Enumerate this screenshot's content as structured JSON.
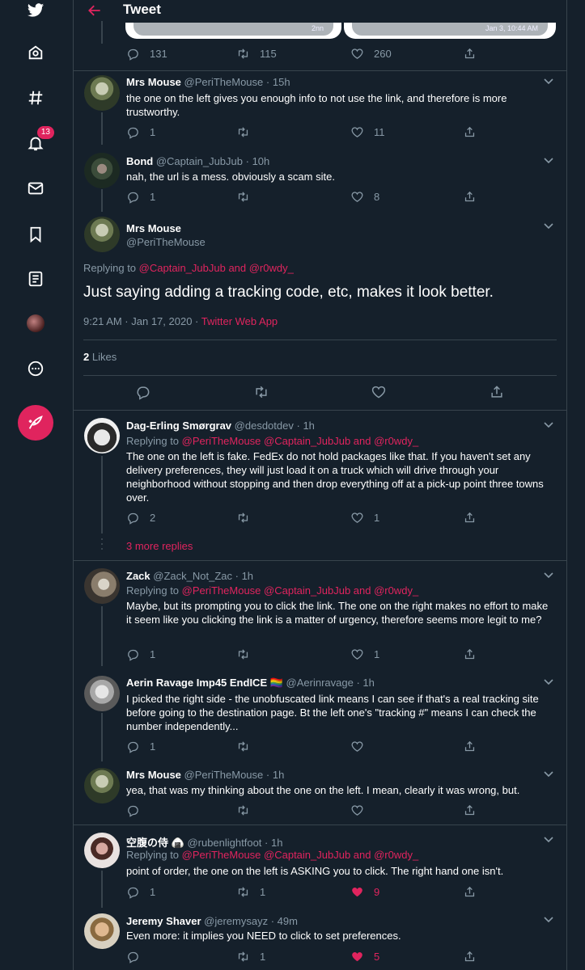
{
  "header": {
    "title": "Tweet"
  },
  "nav": {
    "notification_count": "13"
  },
  "media": {
    "left_caption": "2nn",
    "right_caption": "Jan 3, 10:44 AM"
  },
  "top_tweet": {
    "replies": "131",
    "retweets": "115",
    "likes": "260"
  },
  "tweets": [
    {
      "name": "Mrs Mouse",
      "handle": "@PeriTheMouse",
      "time": "15h",
      "text": "the one on the left gives you enough info to not use the link, and therefore is more trustworthy.",
      "replies": "1",
      "retweets": "",
      "likes": "11"
    },
    {
      "name": "Bond",
      "handle": "@Captain_JubJub",
      "time": "10h",
      "text": "nah, the url is a mess. obviously a scam site.",
      "replies": "1",
      "retweets": "",
      "likes": "8"
    }
  ],
  "focused": {
    "name": "Mrs Mouse",
    "handle": "@PeriTheMouse",
    "replying_prefix": "Replying to",
    "replying_to": "@Captain_JubJub and @r0wdy_",
    "text": "Just saying adding a tracking code, etc, makes it look better.",
    "timestamp": "9:21 AM · Jan 17, 2020 · ",
    "source": "Twitter Web App",
    "likes_count": "2",
    "likes_label": "Likes"
  },
  "replies": [
    {
      "name": "Dag-Erling Smørgrav",
      "handle": "@desdotdev",
      "time": "1h",
      "replying_prefix": "Replying to",
      "replying_to": "@PeriTheMouse @Captain_JubJub and @r0wdy_",
      "text": "The one on the left is fake. FedEx do not hold packages like that. If you haven't set any delivery preferences, they will just load it on a truck which will drive through your neighborhood without stopping and then drop everything off at a pick-up point three towns over.",
      "replies": "2",
      "retweets": "",
      "likes": "1"
    },
    {
      "more_replies": "3 more replies"
    },
    {
      "name": "Zack",
      "handle": "@Zack_Not_Zac",
      "time": "1h",
      "replying_prefix": "Replying to",
      "replying_to": "@PeriTheMouse @Captain_JubJub and @r0wdy_",
      "text": "Maybe, but its prompting you to click the link. The one on the right makes no effort to make it seem like you clicking the link is a matter of urgency, therefore seems more legit to me?",
      "replies": "1",
      "retweets": "",
      "likes": "1"
    },
    {
      "name": "Aerin Ravage Imp45 EndICE 🏳️‍🌈",
      "handle": "@Aerinravage",
      "time": "1h",
      "text": "I picked the right side - the unobfuscated link means I can see if that's a real tracking site before going to the destination page. Bt the left one's \"tracking #\" means I can check the number independently...",
      "replies": "1",
      "retweets": "",
      "likes": ""
    },
    {
      "name": "Mrs Mouse",
      "handle": "@PeriTheMouse",
      "time": "1h",
      "text": "yea, that was my thinking about the one on the left.   I mean, clearly it was wrong, but.",
      "replies": "",
      "retweets": "",
      "likes": ""
    },
    {
      "name": "空腹の侍 🍙",
      "handle": "@rubenlightfoot",
      "time": "1h",
      "replying_prefix": "Replying to",
      "replying_to": "@PeriTheMouse @Captain_JubJub and @r0wdy_",
      "text": "point of order, the one on the left is ASKING you to click. The right hand one isn't.",
      "replies": "1",
      "retweets": "1",
      "likes": "9"
    },
    {
      "name": "Jeremy Shaver",
      "handle": "@jeremysayz",
      "time": "49m",
      "text": "Even more: it implies you NEED to click to set preferences.",
      "replies": "",
      "retweets": "1",
      "likes": "5"
    }
  ],
  "colors": {
    "background": "#15202b",
    "accent": "#e0245e",
    "link": "#1da1f2",
    "muted": "#8899a6",
    "border": "#38444d"
  }
}
